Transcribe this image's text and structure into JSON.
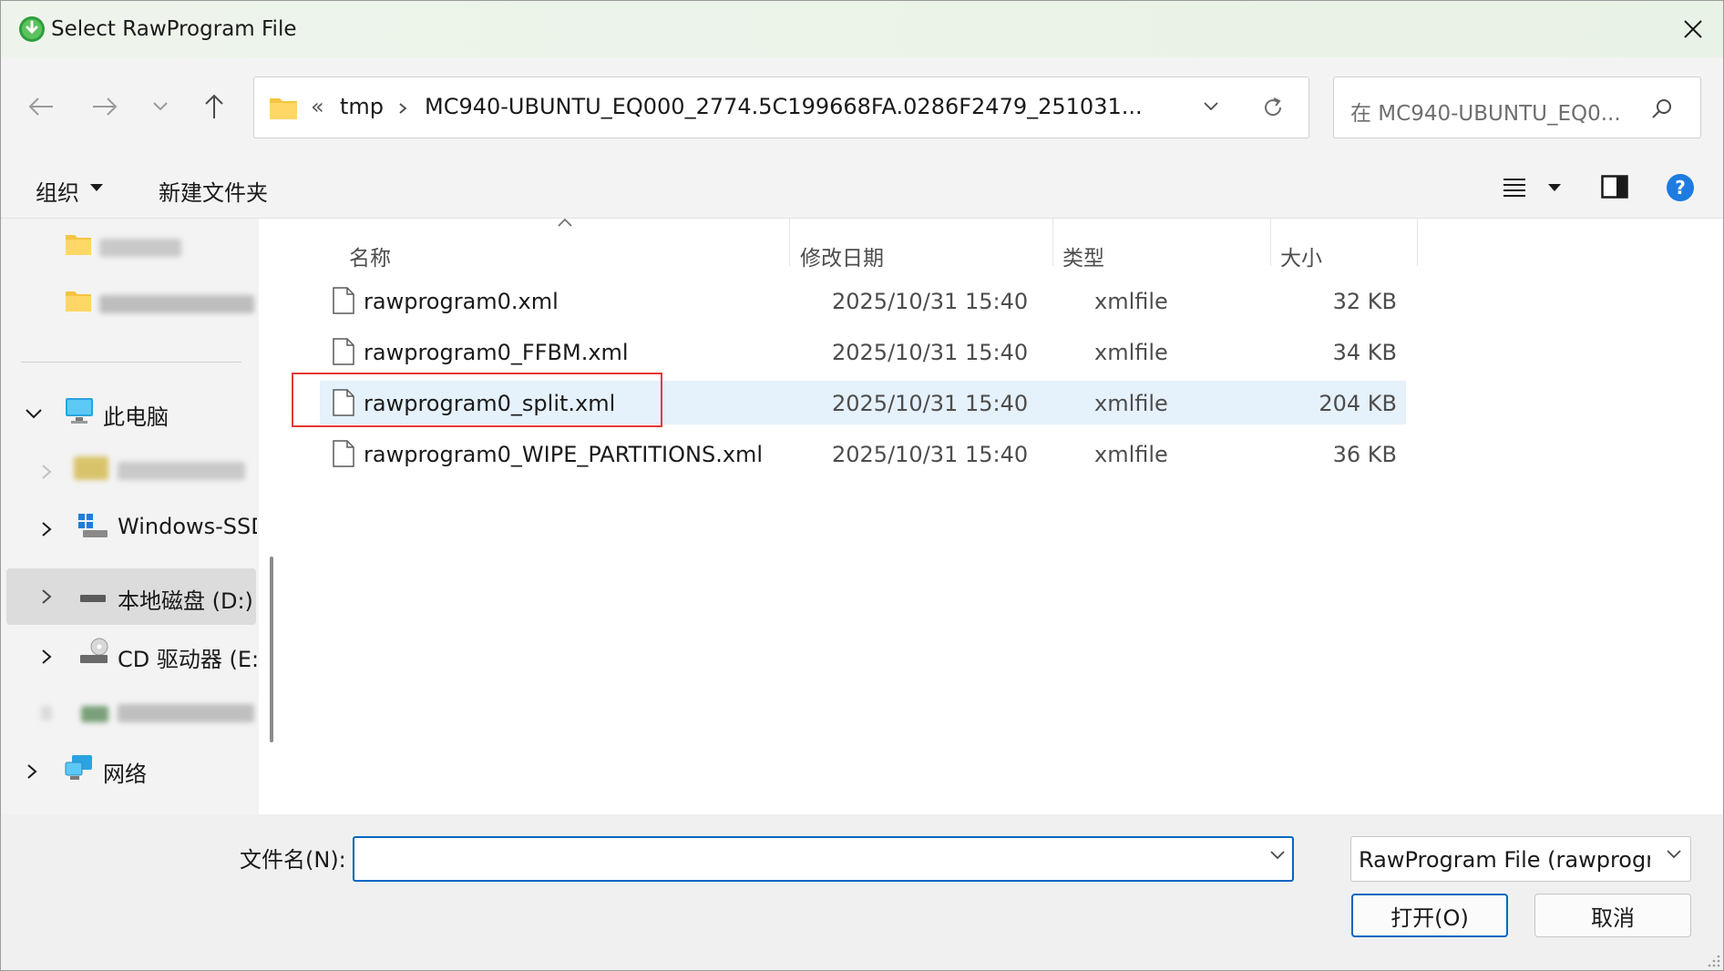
{
  "window": {
    "title": "Select RawProgram File"
  },
  "address": {
    "overflow": "«",
    "crumbs": [
      "tmp",
      "MC940-UBUNTU_EQ000_2774.5C199668FA.0286F2479_251031..."
    ]
  },
  "search": {
    "placeholder": "在 MC940-UBUNTU_EQ0..."
  },
  "toolbar": {
    "organize": "组织",
    "new_folder": "新建文件夹"
  },
  "nav": {
    "this_pc": "此电脑",
    "windows_ssd": "Windows-SSD",
    "local_d": "本地磁盘 (D:)",
    "cd_drive": "CD 驱动器 (E:)",
    "network": "网络"
  },
  "columns": {
    "name": "名称",
    "date": "修改日期",
    "type": "类型",
    "size": "大小"
  },
  "files": [
    {
      "name": "rawprogram0.xml",
      "date": "2025/10/31 15:40",
      "type": "xmlfile",
      "size": "32 KB"
    },
    {
      "name": "rawprogram0_FFBM.xml",
      "date": "2025/10/31 15:40",
      "type": "xmlfile",
      "size": "34 KB"
    },
    {
      "name": "rawprogram0_split.xml",
      "date": "2025/10/31 15:40",
      "type": "xmlfile",
      "size": "204 KB"
    },
    {
      "name": "rawprogram0_WIPE_PARTITIONS.xml",
      "date": "2025/10/31 15:40",
      "type": "xmlfile",
      "size": "36 KB"
    }
  ],
  "footer": {
    "filename_label": "文件名(N):",
    "filename_value": "",
    "filter": "RawProgram File (rawprogram*.xml)",
    "open": "打开(O)",
    "cancel": "取消"
  },
  "colors": {
    "accent": "#0067c0",
    "selection": "#e5f1fb",
    "highlight": "#e53935"
  }
}
